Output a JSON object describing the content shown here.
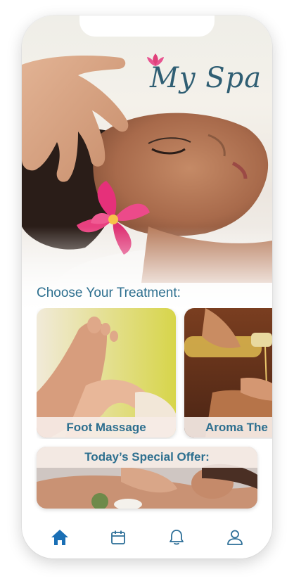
{
  "app": {
    "brand": "My Spa"
  },
  "section": {
    "title": "Choose Your Treatment:"
  },
  "treatments": [
    {
      "label": "Foot Massage"
    },
    {
      "label": "Aroma The"
    }
  ],
  "offer": {
    "title": "Today’s Special Offer:"
  },
  "nav": {
    "items": [
      {
        "icon": "home-icon",
        "active": true
      },
      {
        "icon": "calendar-icon",
        "active": false
      },
      {
        "icon": "bell-icon",
        "active": false
      },
      {
        "icon": "user-icon",
        "active": false
      }
    ]
  },
  "colors": {
    "accent": "#2d6f8f",
    "nav_active": "#1a6fb5",
    "nav_inactive": "#2c6e97",
    "lotus": "#e0407a"
  }
}
